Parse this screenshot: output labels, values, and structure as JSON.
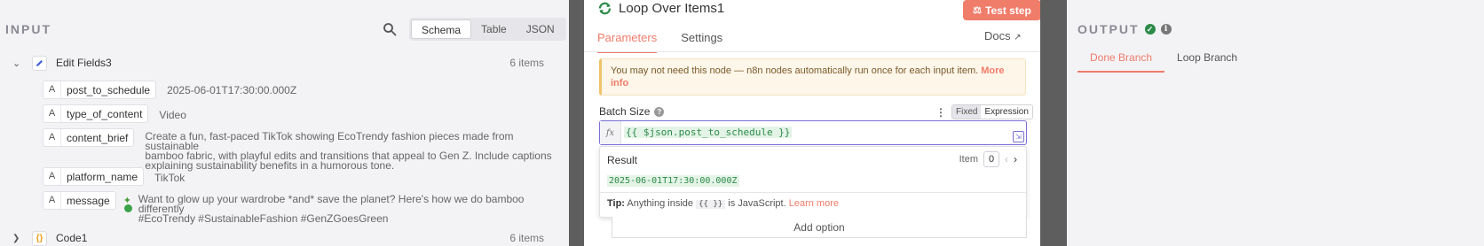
{
  "input": {
    "title": "INPUT",
    "view_tabs": [
      "Schema",
      "Table",
      "JSON"
    ],
    "active_view": "Schema",
    "nodes": [
      {
        "name": "Edit Fields3",
        "count": "6 items",
        "expanded": true
      },
      {
        "name": "Code1",
        "count": "6 items",
        "expanded": false
      }
    ],
    "fields": [
      {
        "key": "post_to_schedule",
        "type": "A",
        "value": "2025-06-01T17:30:00.000Z"
      },
      {
        "key": "type_of_content",
        "type": "A",
        "value": "Video"
      },
      {
        "key": "content_brief",
        "type": "A",
        "value_lines": [
          "Create a fun, fast-paced TikTok showing EcoTrendy fashion pieces made from sustainable",
          "bamboo fabric, with playful edits and transitions that appeal to Gen Z. Include captions",
          "explaining sustainability benefits in a humorous tone."
        ]
      },
      {
        "key": "platform_name",
        "type": "A",
        "value": "TikTok"
      },
      {
        "key": "message",
        "type": "A",
        "value_lines": [
          "Want to glow up your wardrobe *and* save the planet? Here's how we do bamboo differently",
          "#EcoTrendy #SustainableFashion #GenZGoesGreen"
        ]
      }
    ]
  },
  "node_panel": {
    "title": "Loop Over Items1",
    "test_button": "Test step",
    "tabs": [
      "Parameters",
      "Settings"
    ],
    "active_tab": "Parameters",
    "docs_label": "Docs",
    "notice_text": "You may not need this node — n8n nodes automatically run once for each input item.",
    "notice_link_1": "More",
    "notice_link_2": "info",
    "batch_label": "Batch Size",
    "mode_fixed": "Fixed",
    "mode_expression": "Expression",
    "fx_label": "fx",
    "expression": "{{ $json.post_to_schedule }}",
    "result_label": "Result",
    "item_label": "Item",
    "item_index": "0",
    "result_value": "2025-06-01T17:30:00.000Z",
    "tip_bold": "Tip:",
    "tip_text": "Anything inside",
    "tip_code": "{{ }}",
    "tip_text2": "is JavaScript.",
    "tip_link": "Learn more",
    "add_option": "Add option"
  },
  "output": {
    "title": "OUTPUT",
    "tabs": [
      "Done Branch",
      "Loop Branch"
    ],
    "active_tab": "Done Branch"
  },
  "colors": {
    "accent": "#f07c6a",
    "expression_border": "#7a70d6",
    "success": "#2d8a48",
    "warning_bg": "#fdf6e9"
  }
}
